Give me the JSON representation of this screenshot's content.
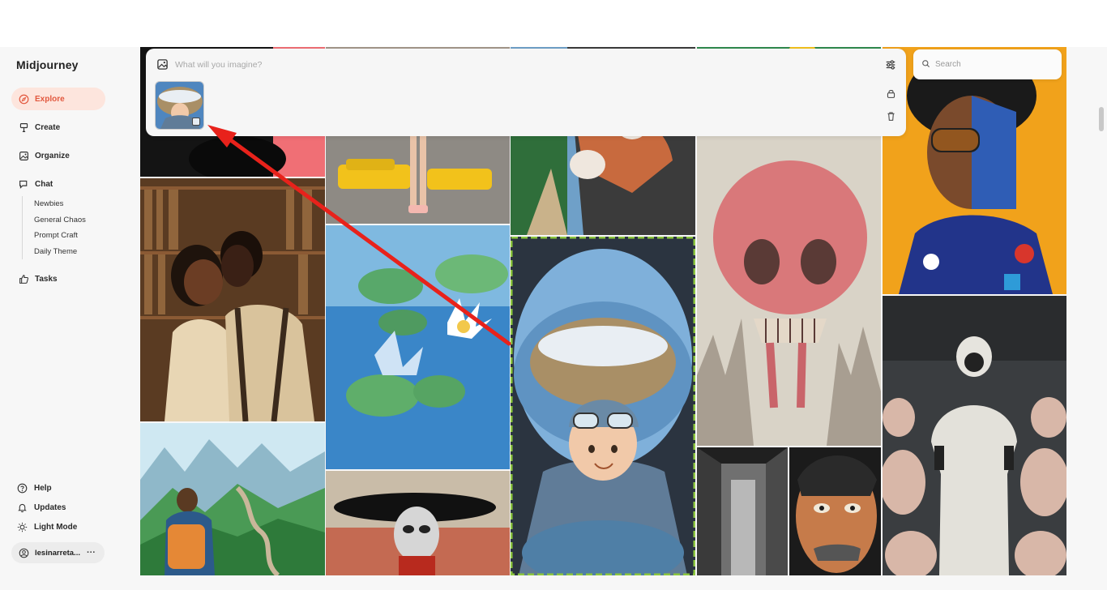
{
  "sidebar": {
    "brand": "Midjourney",
    "nav": [
      {
        "label": "Explore",
        "icon": "compass-icon",
        "active": true
      },
      {
        "label": "Create",
        "icon": "brush-icon"
      },
      {
        "label": "Organize",
        "icon": "image-icon"
      },
      {
        "label": "Chat",
        "icon": "chat-icon"
      }
    ],
    "chat_channels": [
      "Newbies",
      "General Chaos",
      "Prompt Craft",
      "Daily Theme"
    ],
    "tasks_label": "Tasks",
    "tasks_icon": "thumbs-up-icon",
    "bottom": [
      {
        "label": "Help",
        "icon": "help-icon"
      },
      {
        "label": "Updates",
        "icon": "bell-icon"
      },
      {
        "label": "Light Mode",
        "icon": "sun-icon"
      }
    ],
    "user": {
      "name": "lesinarreta...",
      "more": "···"
    }
  },
  "prompt": {
    "placeholder": "What will you imagine?",
    "image_icon": "image-icon",
    "settings_icon": "sliders-icon",
    "lock_icon": "lock-icon",
    "trash_icon": "trash-icon",
    "thumbnail": "baby-pilot-thumbnail"
  },
  "search": {
    "placeholder": "Search",
    "icon": "search-icon"
  },
  "colors": {
    "accent": "#e2583e",
    "accent_bg": "#fde5dd",
    "arrow": "#e8221b",
    "selection": "#8cc63f"
  },
  "gallery": {
    "tiles": [
      "Dark figure on red background",
      "Couple kissing in library",
      "Great Wall hiker",
      "Ballerina with yellow taxis",
      "Water lilies with butterfly",
      "Masked figure with wide hat",
      "Cat driving car",
      "Baby pilot in cockpit",
      "Lemons on green leaves",
      "Pink skull castle",
      "Black and white alley",
      "Comic face portrait",
      "Cyberpunk portrait",
      "Hazmat suit among pigs"
    ]
  }
}
